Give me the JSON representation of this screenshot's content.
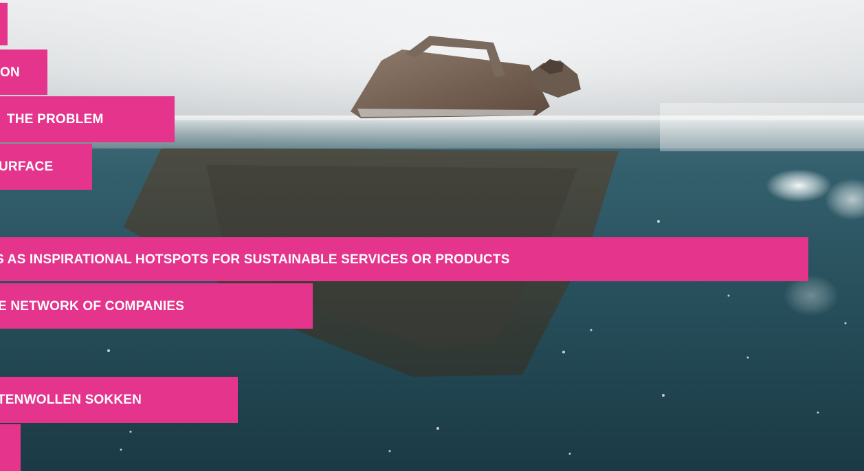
{
  "colors": {
    "accent": "#e5348c",
    "text_on_accent": "#ffffff",
    "sky": "#e9ebec",
    "water": "#2e5966"
  },
  "menu": {
    "items": [
      {
        "label": ""
      },
      {
        "label": "ON"
      },
      {
        "label": "THE PROBLEM"
      },
      {
        "label": "URFACE"
      },
      {
        "label": "S AS INSPIRATIONAL HOTSPOTS FOR SUSTAINABLE SERVICES OR PRODUCTS"
      },
      {
        "label": "E NETWORK OF COMPANIES"
      },
      {
        "label": "TENWOLLEN SOKKEN"
      },
      {
        "label": ""
      }
    ]
  }
}
